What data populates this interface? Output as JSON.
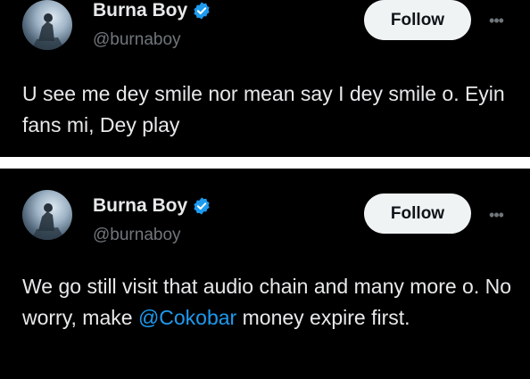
{
  "tweets": [
    {
      "author_name": "Burna Boy",
      "handle": "@burnaboy",
      "follow_label": "Follow",
      "more_label": "•••",
      "text": "U see me dey smile nor mean say I dey smile o. Eyin fans mi, Dey play"
    },
    {
      "author_name": "Burna Boy",
      "handle": "@burnaboy",
      "follow_label": "Follow",
      "more_label": "•••",
      "text_before": "We go still visit that audio chain and many more o. No worry, make ",
      "mention": "@Cokobar",
      "text_after": " money expire first."
    }
  ],
  "colors": {
    "background": "#000000",
    "text": "#e7e9ea",
    "secondary_text": "#71767b",
    "link": "#1d9bf0",
    "verified_badge": "#1d9bf0",
    "follow_button_bg": "#eff3f4",
    "follow_button_text": "#0f1419"
  },
  "icons": {
    "verified": "verified-badge-icon",
    "more": "more-options-icon"
  }
}
